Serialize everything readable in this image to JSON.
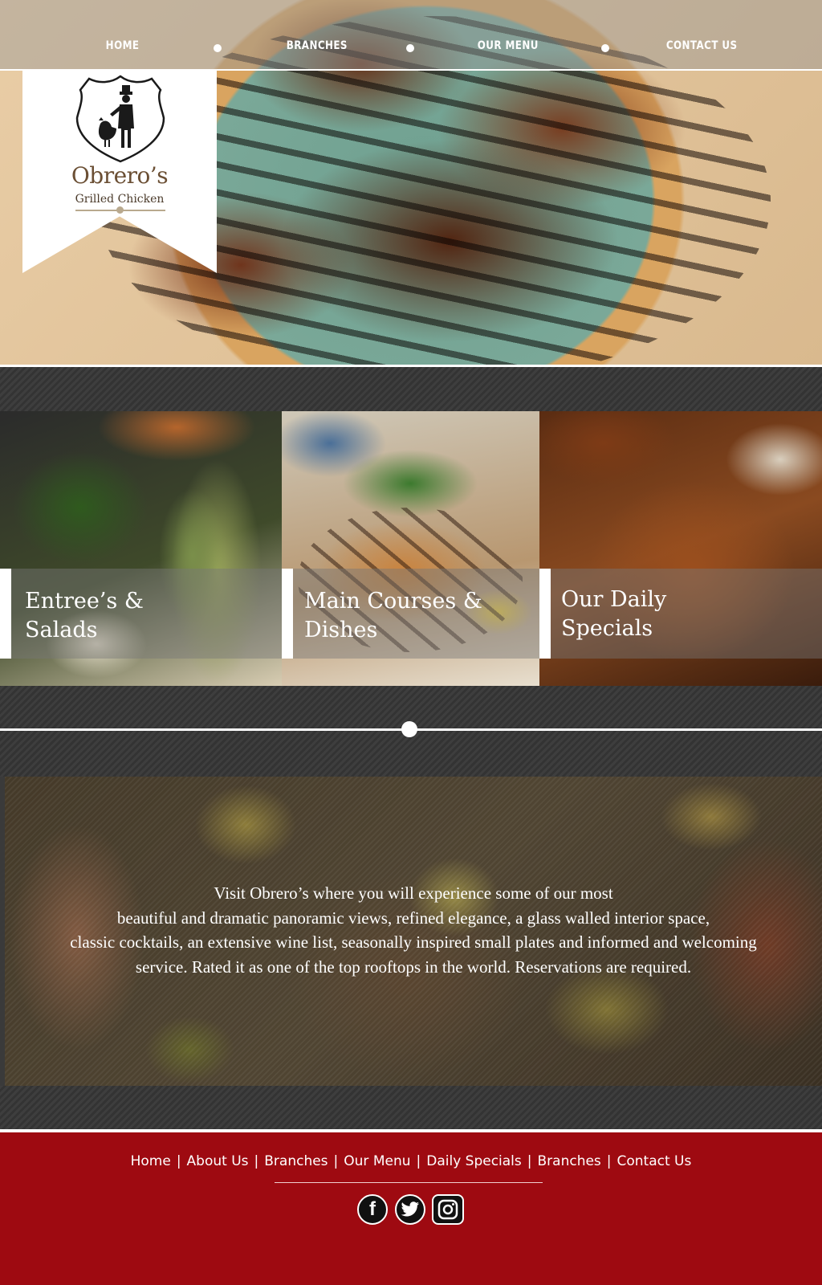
{
  "nav": {
    "items": [
      {
        "label": "HOME"
      },
      {
        "label": "BRANCHES"
      },
      {
        "label": "OUR MENU"
      },
      {
        "label": "CONTACT US"
      }
    ]
  },
  "logo": {
    "name": "Obrero’s",
    "subtitle": "Grilled Chicken"
  },
  "categories": [
    {
      "line1": "Entree’s &",
      "line2": "Salads"
    },
    {
      "line1": "Main Courses &",
      "line2": "Dishes"
    },
    {
      "line1": "Our Daily",
      "line2": "Specials"
    }
  ],
  "about": {
    "lines": [
      "Visit Obrero’s where you will experience some of our most",
      "beautiful and dramatic panoramic views, refined elegance, a glass walled interior space,",
      "classic cocktails, an extensive wine list, seasonally inspired small plates and informed and welcoming",
      "service.  Rated it as one of the top rooftops in the world. Reservations are required."
    ]
  },
  "footer": {
    "links": [
      {
        "label": "Home"
      },
      {
        "label": "About Us"
      },
      {
        "label": "Branches"
      },
      {
        "label": "Our Menu"
      },
      {
        "label": "Daily Specials"
      },
      {
        "label": "Branches"
      },
      {
        "label": "Contact Us"
      }
    ],
    "separator": "|",
    "social": [
      {
        "icon": "facebook-icon",
        "glyph": "f"
      },
      {
        "icon": "twitter-icon"
      },
      {
        "icon": "instagram-icon"
      }
    ]
  },
  "colors": {
    "footer_bg": "#9e0a11",
    "band_bg": "#3a3a3a",
    "accent": "#ffffff"
  }
}
